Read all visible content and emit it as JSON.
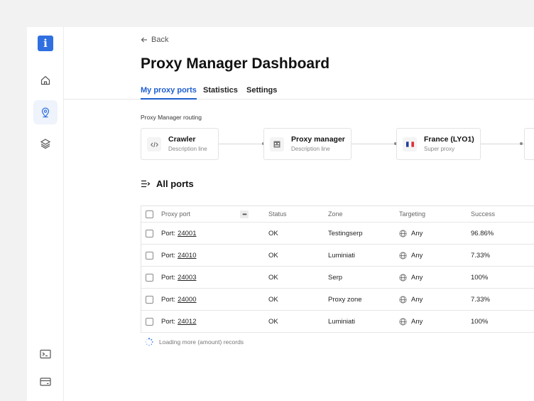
{
  "app": {
    "logo_letter": "i"
  },
  "sidebar": {
    "items": [
      {
        "name": "home",
        "icon": "home-icon",
        "active": false
      },
      {
        "name": "location",
        "icon": "location-pin-icon",
        "active": true
      },
      {
        "name": "layers",
        "icon": "layers-icon",
        "active": false
      },
      {
        "name": "terminal",
        "icon": "terminal-icon",
        "active": false
      },
      {
        "name": "billing",
        "icon": "credit-card-icon",
        "active": false
      }
    ]
  },
  "header": {
    "back_label": "Back",
    "title": "Proxy Manager Dashboard"
  },
  "tabs": [
    {
      "label": "My proxy ports",
      "active": true
    },
    {
      "label": "Statistics",
      "active": false
    },
    {
      "label": "Settings",
      "active": false
    }
  ],
  "routing": {
    "label": "Proxy Manager routing",
    "nodes": [
      {
        "title": "Crawler",
        "desc": "Description line",
        "icon": "code-icon"
      },
      {
        "title": "Proxy manager",
        "desc": "Description line",
        "icon": "proxy-manager-icon"
      },
      {
        "title": "France (LYO1)",
        "desc": "Super proxy",
        "icon": "france-flag-icon"
      }
    ]
  },
  "ports": {
    "title": "All ports",
    "columns": [
      "Proxy port",
      "Status",
      "Zone",
      "Targeting",
      "Success"
    ],
    "port_prefix": "Port:",
    "rows": [
      {
        "port": "24001",
        "status": "OK",
        "zone": "Testingserp",
        "targeting": "Any",
        "success": "96.86%"
      },
      {
        "port": "24010",
        "status": "OK",
        "zone": "Luminiati",
        "targeting": "Any",
        "success": "7.33%"
      },
      {
        "port": "24003",
        "status": "OK",
        "zone": "Serp",
        "targeting": "Any",
        "success": "100%"
      },
      {
        "port": "24000",
        "status": "OK",
        "zone": "Proxy zone",
        "targeting": "Any",
        "success": "7.33%"
      },
      {
        "port": "24012",
        "status": "OK",
        "zone": "Luminiati",
        "targeting": "Any",
        "success": "100%"
      }
    ],
    "loading_text": "Loading more (amount) records"
  },
  "colors": {
    "accent": "#1f5fcf",
    "logo": "#2f6fe0",
    "active_nav_bg": "#eef3fc"
  }
}
